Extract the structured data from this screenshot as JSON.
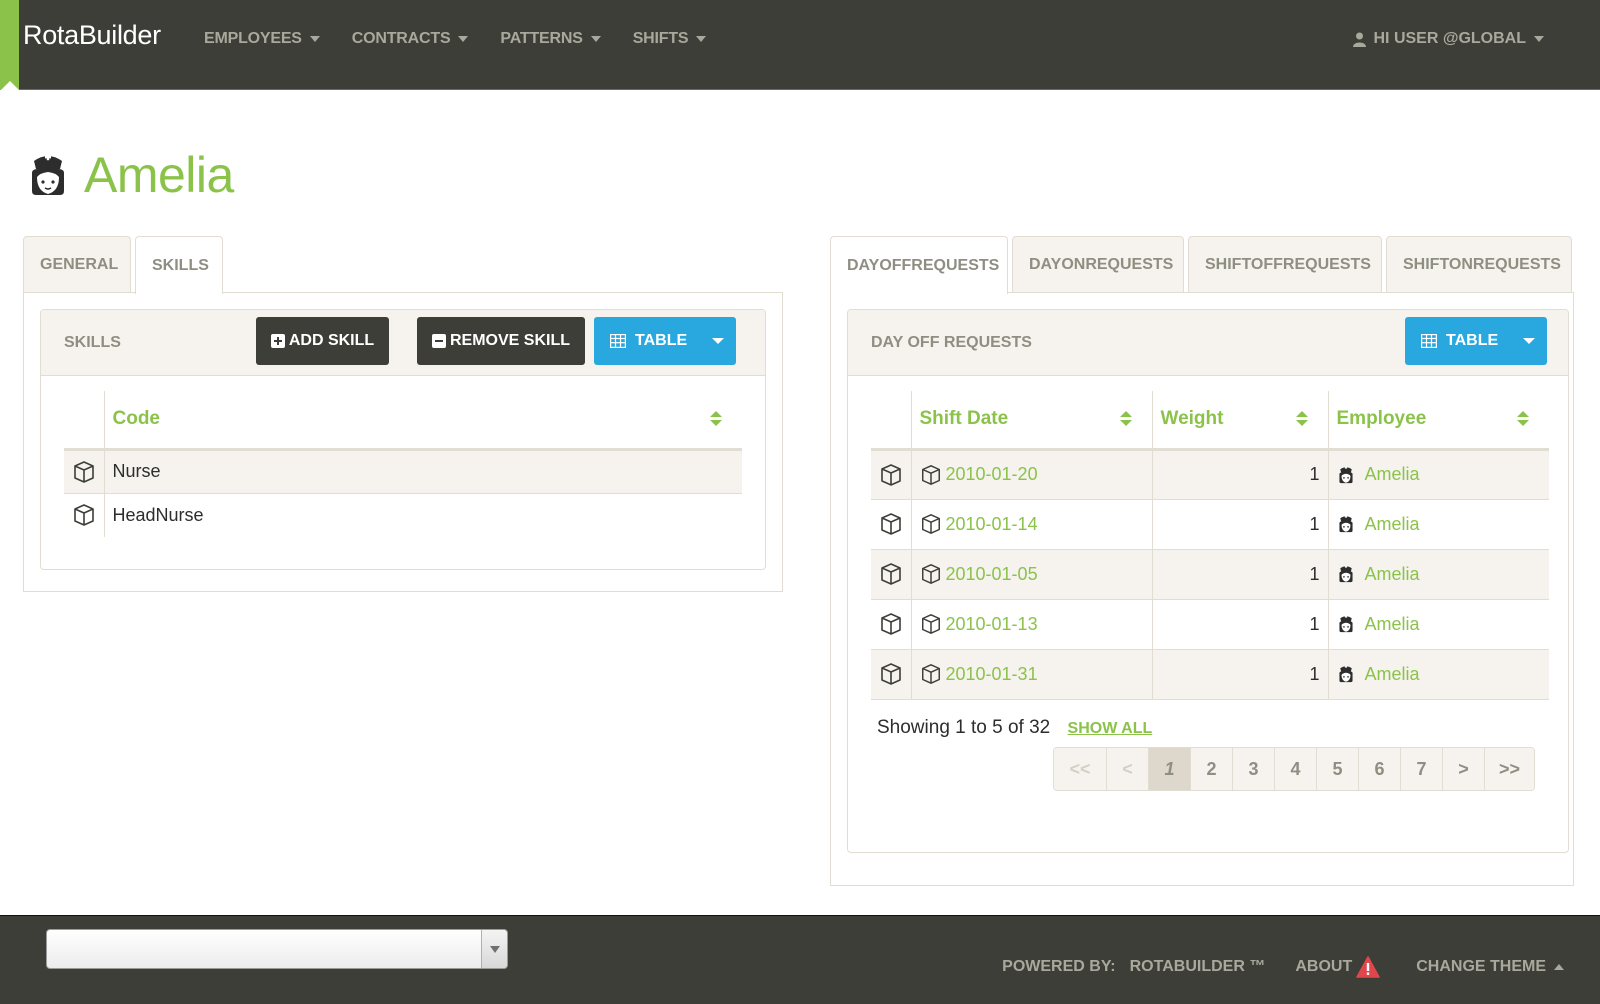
{
  "navbar": {
    "brand": "RotaBuilder",
    "menu": [
      {
        "label": "EMPLOYEES"
      },
      {
        "label": "CONTRACTS"
      },
      {
        "label": "PATTERNS"
      },
      {
        "label": "SHIFTS"
      }
    ],
    "user_label": "HI USER @GLOBAL",
    "user_icon": "user-icon"
  },
  "page": {
    "title": "Amelia",
    "avatar_icon": "nurse-icon"
  },
  "left": {
    "tabs": [
      {
        "label": "GENERAL",
        "active": false
      },
      {
        "label": "SKILLS",
        "active": true
      }
    ],
    "panel": {
      "title": "SKILLS",
      "add_label": "ADD SKILL",
      "remove_label": "REMOVE SKILL",
      "view_label": "TABLE"
    },
    "table": {
      "columns": [
        "Code"
      ],
      "rows": [
        {
          "code": "Nurse"
        },
        {
          "code": "HeadNurse"
        }
      ]
    }
  },
  "right": {
    "tabs": [
      {
        "label": "DAYOFFREQUESTS",
        "active": true
      },
      {
        "label": "DAYONREQUESTS",
        "active": false
      },
      {
        "label": "SHIFTOFFREQUESTS",
        "active": false
      },
      {
        "label": "SHIFTONREQUESTS",
        "active": false
      }
    ],
    "panel": {
      "title": "DAY OFF REQUESTS",
      "view_label": "TABLE"
    },
    "table": {
      "columns": [
        "Shift Date",
        "Weight",
        "Employee"
      ],
      "rows": [
        {
          "shift_date": "2010-01-20",
          "weight": "1",
          "employee": "Amelia"
        },
        {
          "shift_date": "2010-01-14",
          "weight": "1",
          "employee": "Amelia"
        },
        {
          "shift_date": "2010-01-05",
          "weight": "1",
          "employee": "Amelia"
        },
        {
          "shift_date": "2010-01-13",
          "weight": "1",
          "employee": "Amelia"
        },
        {
          "shift_date": "2010-01-31",
          "weight": "1",
          "employee": "Amelia"
        }
      ]
    },
    "pagination": {
      "showing": "Showing 1 to 5 of 32",
      "show_all": "SHOW ALL",
      "first": "<<",
      "prev": "<",
      "pages": [
        "1",
        "2",
        "3",
        "4",
        "5",
        "6",
        "7"
      ],
      "current": "1",
      "next": ">",
      "last": ">>"
    }
  },
  "footer": {
    "select_value": "",
    "powered_by": "POWERED BY:",
    "brand": "ROTABUILDER ™",
    "about": "ABOUT",
    "change_theme": "CHANGE THEME"
  },
  "colors": {
    "accent": "#8bc34a",
    "navbar": "#3e3e38",
    "primary_button": "#29a8e0",
    "warning": "#e0474c"
  }
}
